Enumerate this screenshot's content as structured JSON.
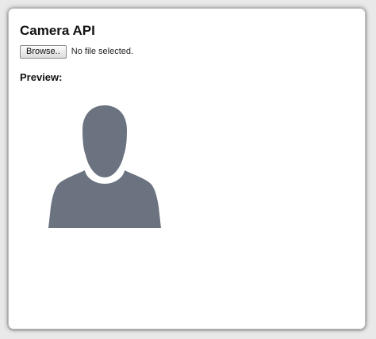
{
  "page": {
    "title": "Camera API"
  },
  "file_input": {
    "button_label": "Browse..",
    "status_text": "No file selected."
  },
  "preview": {
    "label": "Preview:",
    "image_icon": "user-silhouette-icon",
    "icon_color": "#6b7380"
  }
}
